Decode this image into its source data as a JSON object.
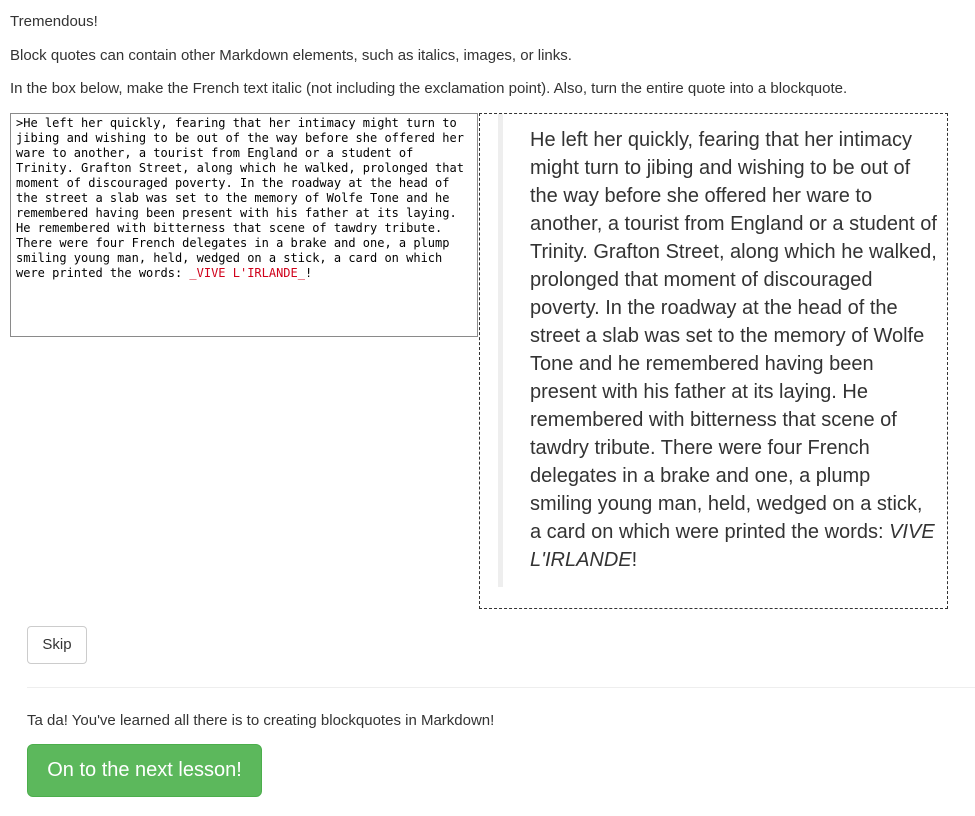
{
  "lesson": {
    "praise": "Tremendous!",
    "explanation": "Block quotes can contain other Markdown elements, such as italics, images, or links.",
    "instruction": "In the box below, make the French text italic (not including the exclamation point). Also, turn the entire quote into a blockquote."
  },
  "editor": {
    "text_before": ">He left her quickly, fearing that her intimacy might turn to jibing and wishing to be out of the way before she offered her ware to another, a tourist from England or a student of Trinity. Grafton Street, along which he walked, prolonged that moment of discouraged poverty. In the roadway at the head of the street a slab was set to the memory of Wolfe Tone and he remembered having been present with his father at its laying. He remembered with bitterness that scene of tawdry tribute. There were four French delegates in a brake and one, a plump smiling young man, held, wedged on a stick, a card on which were printed the words: ",
    "italic_markup": "_VIVE L'IRLANDE_",
    "text_after": "!"
  },
  "preview": {
    "quote_text": "He left her quickly, fearing that her intimacy might turn to jibing and wishing to be out of the way before she offered her ware to another, a tourist from England or a student of Trinity. Grafton Street, along which he walked, prolonged that moment of discouraged poverty. In the roadway at the head of the street a slab was set to the memory of Wolfe Tone and he remembered having been present with his father at its laying. He remembered with bitterness that scene of tawdry tribute. There were four French delegates in a brake and one, a plump smiling young man, held, wedged on a stick, a card on which were printed the words: ",
    "italic_text": "VIVE L'IRLANDE",
    "after_text": "!"
  },
  "buttons": {
    "skip_label": "Skip",
    "next_label": "On to the next lesson!"
  },
  "completion": {
    "message": "Ta da! You've learned all there is to creating blockquotes in Markdown!"
  },
  "colors": {
    "next_button": "#5cb85c",
    "markup_highlight": "#d0021b"
  }
}
